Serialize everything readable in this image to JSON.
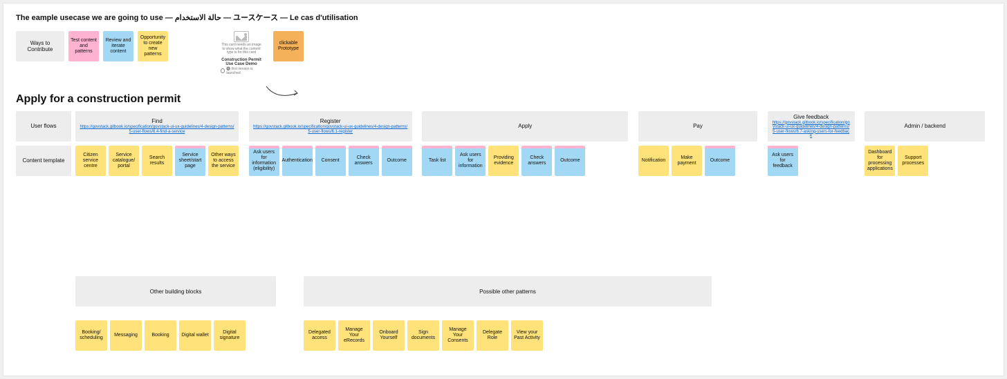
{
  "page_title": "The eample usecase we are going to use — حالة الاستخدام — ユースケース — Le cas d'utilisation",
  "ways": {
    "label": "Ways to Contribute",
    "items": [
      {
        "color": "pink",
        "text": "Test content and patterns"
      },
      {
        "color": "blue",
        "text": "Review and iterate content"
      },
      {
        "color": "yellow",
        "text": "Opportunity to create new patterns"
      }
    ],
    "placeholder": {
      "caption_line1": "This card needs an image",
      "caption_line2": "to show what the content",
      "caption_line3": "type is for this card",
      "title": "Construction Permit Use Case Demo",
      "radio": "🔘 first version is launched"
    },
    "prototype": "clickable Prototype"
  },
  "section_heading": "Apply for a construction permit",
  "flow": {
    "row_labels": {
      "userflows": "User flows",
      "content": "Content template"
    },
    "columns": {
      "find": {
        "title": "Find",
        "link": "https://govstack.gitbook.io/specification/govstack-ui-ux-guidelines/4-design-patterns/5-user-flows/6.4-find-a-service",
        "stickies": [
          {
            "color": "yellow",
            "text": "Citizen service centre"
          },
          {
            "color": "yellow",
            "text": "Service catalogue/ portal"
          },
          {
            "color": "yellow",
            "text": "Search results"
          },
          {
            "color": "blue-pink",
            "text": "Service sheet/start page"
          },
          {
            "color": "yellow",
            "text": "Other ways to access the service"
          }
        ]
      },
      "register": {
        "title": "Register",
        "link": "https://govstack.gitbook.io/specification/govstack-ui-ux-guidelines/4-design-patterns/5-user-flows/6.1-register",
        "stickies": [
          {
            "color": "blue-pink",
            "text": "Ask users for information (eligibility)"
          },
          {
            "color": "blue-pink",
            "text": "Authentication"
          },
          {
            "color": "blue-pink",
            "text": "Consent"
          },
          {
            "color": "blue-pink",
            "text": "Check answers"
          },
          {
            "color": "blue-pink",
            "text": "Outcome"
          }
        ]
      },
      "apply": {
        "title": "Apply",
        "stickies": [
          {
            "color": "blue-pink",
            "text": "Task list"
          },
          {
            "color": "blue-pink",
            "text": "Ask users for information"
          },
          {
            "color": "yellow",
            "text": "Providing evidence"
          },
          {
            "color": "blue-pink",
            "text": "Check answers"
          },
          {
            "color": "blue-pink",
            "text": "Outcome"
          }
        ]
      },
      "pay": {
        "title": "Pay",
        "stickies": [
          {
            "color": "yellow",
            "text": "Notification"
          },
          {
            "color": "yellow",
            "text": "Make payment"
          },
          {
            "color": "blue-pink",
            "text": "Outcome"
          }
        ]
      },
      "feedback": {
        "title": "Give feedback",
        "link": "https://govstack.gitbook.io/specification/govstack-ui-ux-guidelines/4-design-patterns/5-user-flows/6.7-asking-users-for-feedback",
        "stickies": [
          {
            "color": "blue-pink",
            "text": "Ask users for feedback"
          }
        ]
      },
      "admin": {
        "title": "Admin / backend",
        "stickies": [
          {
            "color": "yellow",
            "text": "Dashboard for processing applications"
          },
          {
            "color": "yellow",
            "text": "Support processes"
          }
        ]
      }
    }
  },
  "bottom": {
    "other_bb": {
      "title": "Other building blocks",
      "stickies": [
        "Booking/ scheduling",
        "Messaging",
        "Booking",
        "Digital wallet",
        "Digital signature"
      ]
    },
    "other_patterns": {
      "title": "Possible other patterns",
      "stickies": [
        "Delegated access",
        "Manage Your eRecords",
        "Onboard Yourself",
        "Sign documents",
        "Manage Your Consents",
        "Delegate Role",
        "View your Past Activity"
      ]
    }
  }
}
